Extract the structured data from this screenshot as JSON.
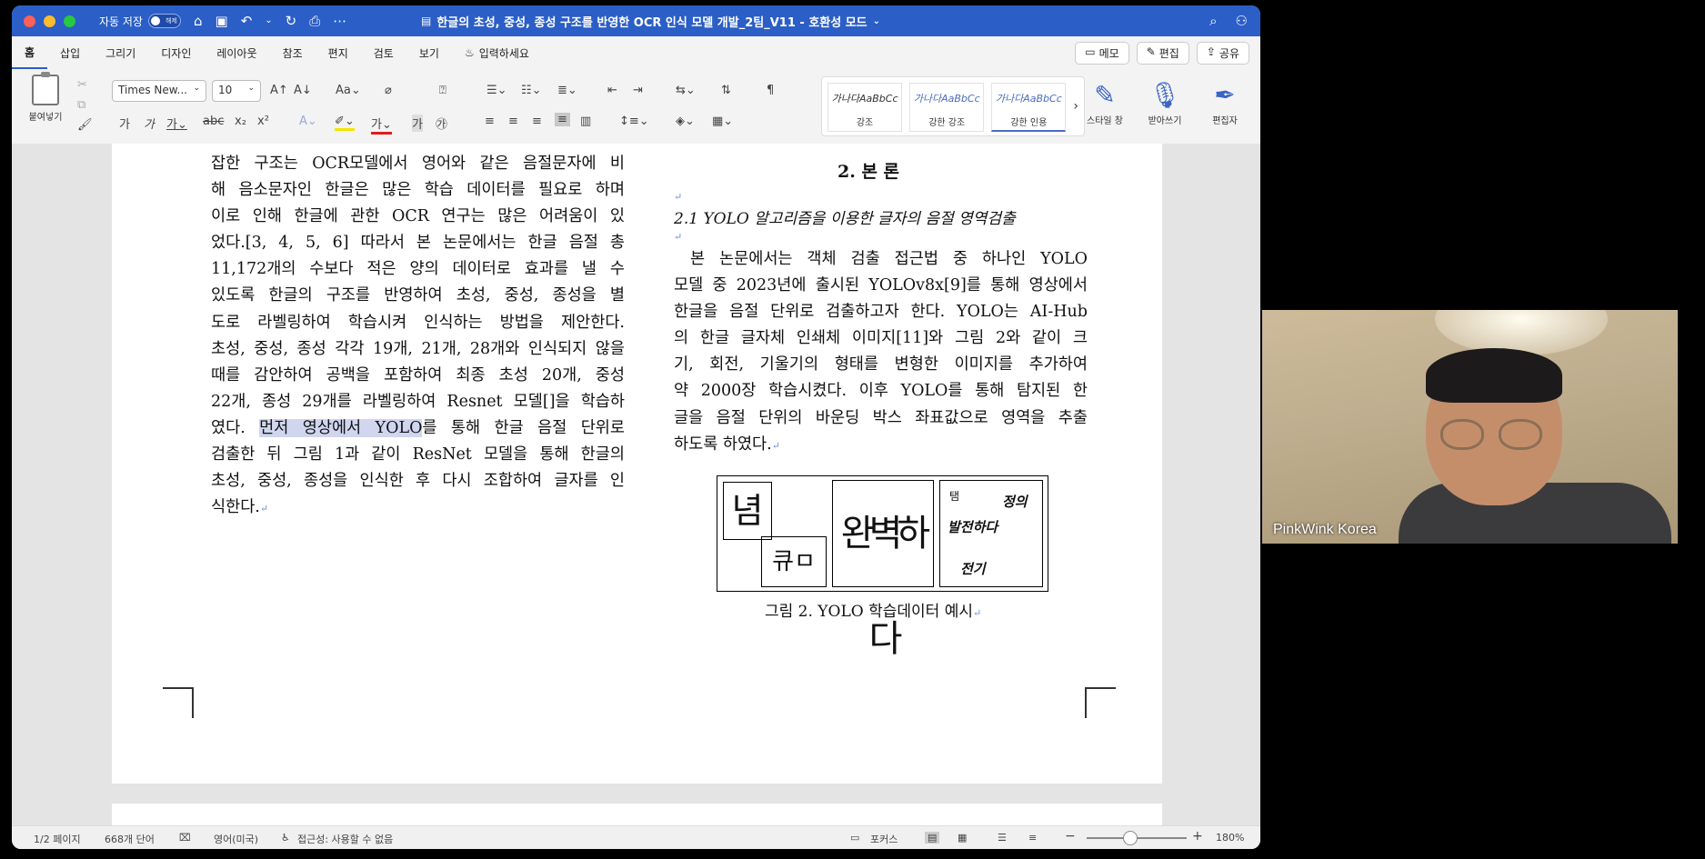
{
  "titlebar": {
    "autosave_label": "자동 저장",
    "toggle_text": "해제",
    "doc_title": "한글의 초성, 중성, 종성 구조를 반영한 OCR 인식 모델 개발_2팀_V11 - 호환성 모드",
    "colors": {
      "bar": "#2b5ec6",
      "close": "#ff5f57",
      "min": "#febc2e",
      "max": "#28c840"
    }
  },
  "ribbon_tabs": [
    "홈",
    "삽입",
    "그리기",
    "디자인",
    "레이아웃",
    "참조",
    "편지",
    "검토",
    "보기"
  ],
  "ribbon_search": "입력하세요",
  "ribbon_actions": {
    "memo": "메모",
    "edit": "편집",
    "share": "공유"
  },
  "ribbon": {
    "paste_label": "붙여넣기",
    "font_name": "Times New...",
    "font_size": "10",
    "styles": [
      {
        "sample": "가나다AaBbCc",
        "name": "강조"
      },
      {
        "sample": "가나다AaBbCc",
        "name": "강한 강조"
      },
      {
        "sample": "가나다AaBbCc",
        "name": "강한 인용"
      }
    ],
    "style_pane_label": "스타일 창",
    "dictate_label": "받아쓰기",
    "editor_label": "편집자"
  },
  "document": {
    "left_lines": [
      "잡한 구조는 OCR모델에서 영어와 같은 음절문자에 비",
      "해 음소문자인 한글은 많은 학습 데이터를 필요로 하며",
      "이로 인해 한글에 관한 OCR 연구는 많은 어려움이 있",
      "었다.[3, 4, 5, 6] 따라서 본 논문에서는 한글 음절 총",
      "11,172개의 수보다 적은 양의 데이터로 효과를 낼 수",
      "있도록 한글의 구조를 반영하여 초성, 중성, 종성을 별",
      "도로 라벨링하여 학습시켜 인식하는 방법을 제안한다.",
      "초성, 중성, 종성 각각 19개, 21개, 28개와 인식되지 않을",
      "때를 감안하여 공백을 포함하여 최종 초성 20개, 중성",
      "22개, 종성 29개를 라벨링하여 Resnet 모델[]을 학습하",
      "였다. 먼저 영상에서 YOLO를 통해 한글 음절 단위로",
      "검출한 뒤 그림 1과 같이 ResNet 모델을 통해 한글의",
      "초성, 중성, 종성을 인식한 후 다시 조합하여 글자를 인",
      "식한다."
    ],
    "highlight": "먼저 영상에서 YOLO",
    "section_heading": "2. 본 론",
    "subsection_heading": "2.1 YOLO 알고리즘을 이용한 글자의 음절 영역검출",
    "right_lines": [
      "본 논문에서는 객체 검출 접근법 중 하나인 YOLO",
      "모델 중 2023년에 출시된 YOLOv8x[9]를 통해 영상에서",
      "한글을 음절 단위로 검출하고자 한다. YOLO는 AI-Hub",
      "의 한글 글자체 인쇄체 이미지[11]와 그림 2와 같이 크",
      "기, 회전, 기울기의 형태를 변형한 이미지를 추가하여",
      "약 2000장 학습시켰다. 이후 YOLO를 통해 탐지된 한",
      "글을 음절 단위의 바운딩 박스 좌표값으로 영역을 추출",
      "하도록 하였다."
    ],
    "figure": {
      "glyph1": "념",
      "glyph2": "큐ㅁ",
      "glyph3": "완벽하다",
      "text_a": "탬",
      "text_b": "정의",
      "text_c": "발전하다",
      "text_d": "전기"
    },
    "figure_caption": "그림 2. YOLO 학습데이터 예시"
  },
  "statusbar": {
    "page": "1/2 페이지",
    "words": "668개 단어",
    "language": "영어(미국)",
    "accessibility": "접근성: 사용할 수 없음",
    "focus": "포커스",
    "zoom": "180%",
    "zoom_level_percent": 180
  },
  "webcam": {
    "name": "PinkWink Korea"
  }
}
